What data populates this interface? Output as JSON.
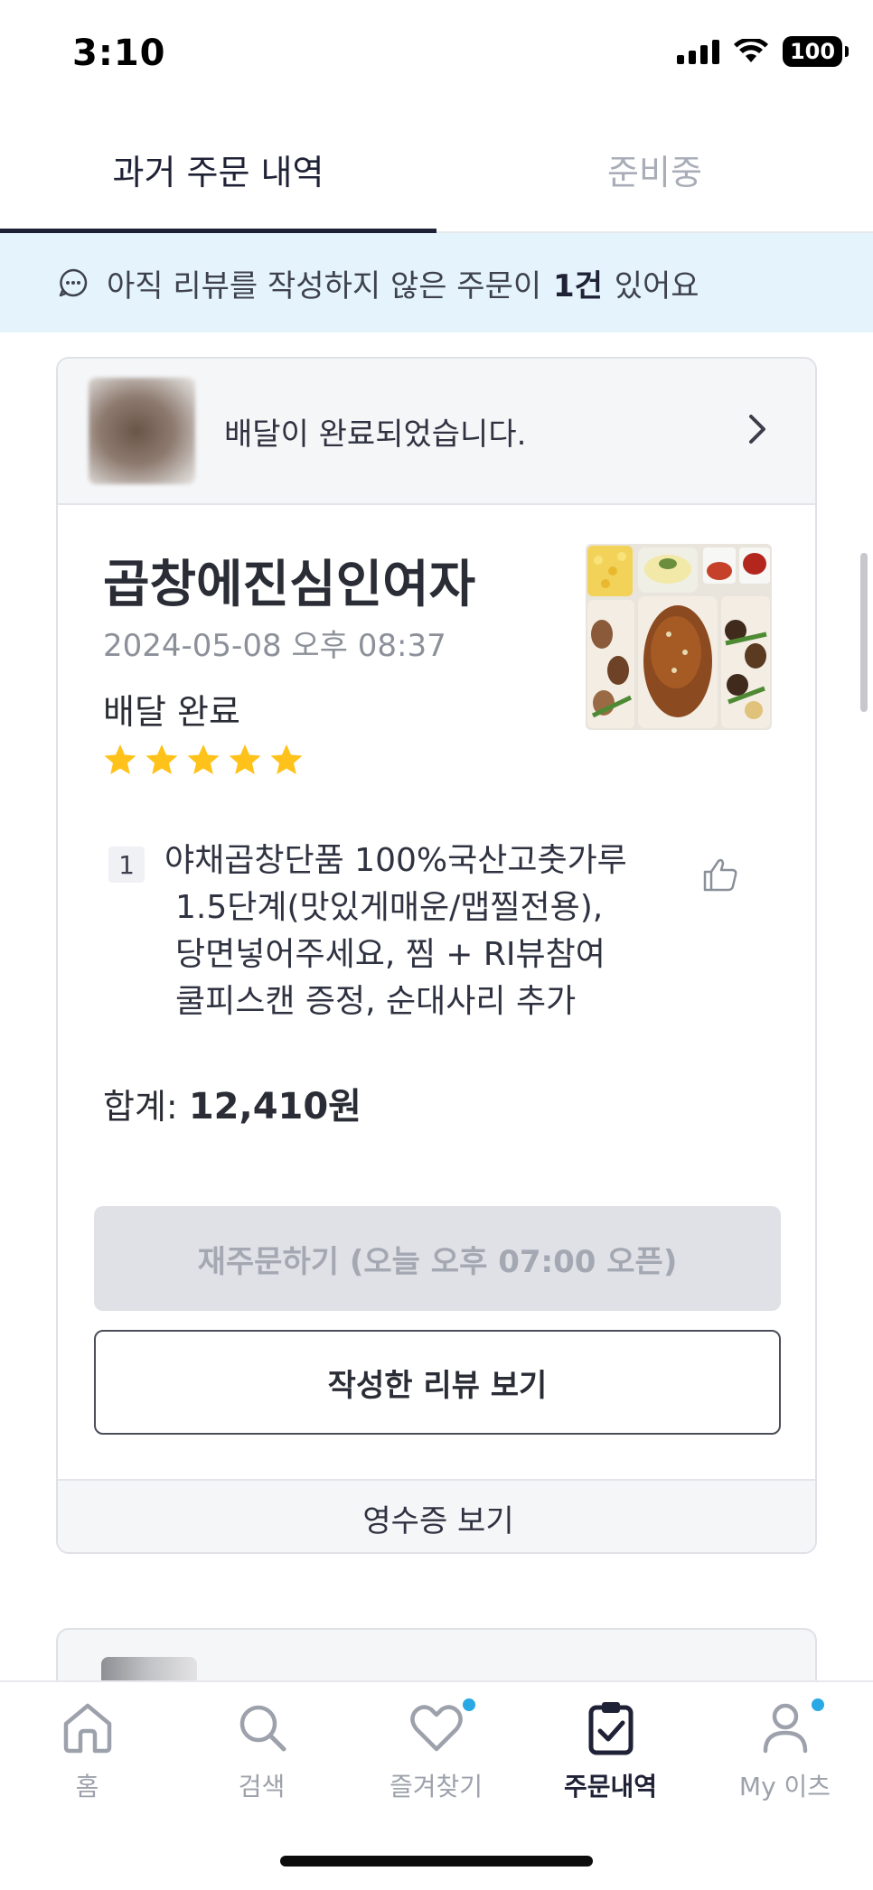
{
  "status_bar": {
    "time": "3:10",
    "battery": "100"
  },
  "tabs": [
    {
      "label": "과거 주문 내역",
      "active": true
    },
    {
      "label": "준비중",
      "active": false
    }
  ],
  "review_banner": {
    "text_before": "아직 리뷰를 작성하지 않은 주문이",
    "count": "1건",
    "text_after": "있어요"
  },
  "order": {
    "header_message": "배달이 완료되었습니다.",
    "store_name": "곱창에진심인여자",
    "date": "2024-05-08 오후 08:37",
    "status": "배달 완료",
    "rating": 5,
    "items": [
      {
        "qty": "1",
        "line1": "야채곱창단품 100%국산고춧가루",
        "line2": "1.5단계(맛있게매운/맵찔전용),",
        "line3": "당면넣어주세요, 찜 + RI뷰참여",
        "line4": "쿨피스캔 증정, 순대사리 추가"
      }
    ],
    "total_label": "합계:",
    "total_value": "12,410원",
    "reorder_label": "재주문하기 (오늘 오후 07:00 오픈)",
    "view_review_label": "작성한 리뷰 보기",
    "receipt_label": "영수증 보기"
  },
  "bottom_nav": [
    {
      "label": "홈",
      "icon": "home-icon",
      "active": false
    },
    {
      "label": "검색",
      "icon": "search-icon",
      "active": false
    },
    {
      "label": "즐겨찾기",
      "icon": "heart-icon",
      "active": false,
      "dot": true
    },
    {
      "label": "주문내역",
      "icon": "clipboard-check-icon",
      "active": true
    },
    {
      "label": "My 이츠",
      "icon": "person-icon",
      "active": false,
      "dot": true
    }
  ],
  "colors": {
    "accent_dark": "#1f2236",
    "banner_bg": "#e5f4fc",
    "star": "#ffc21a",
    "notification_dot": "#29a8e6"
  }
}
